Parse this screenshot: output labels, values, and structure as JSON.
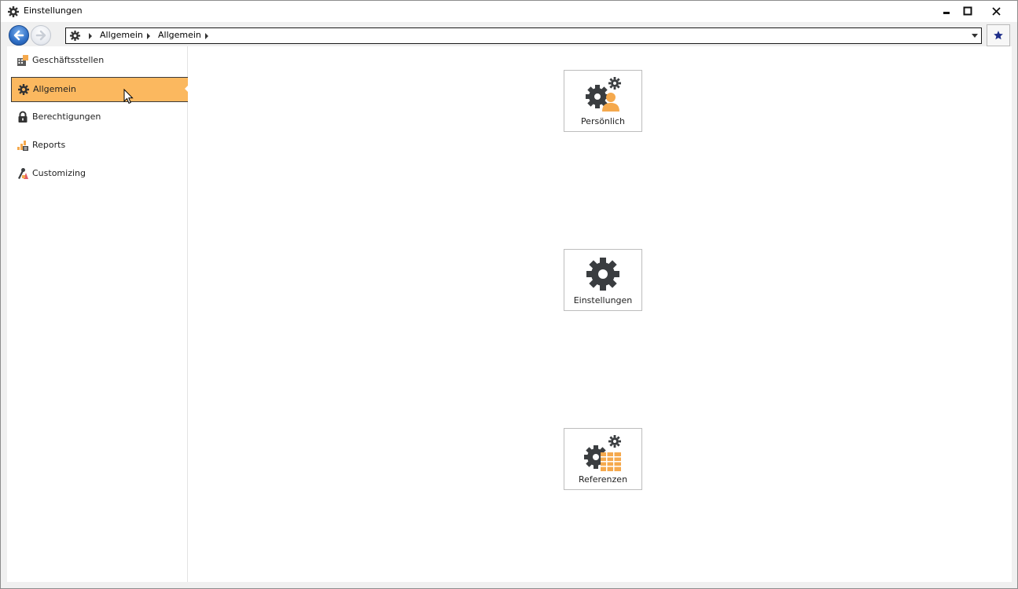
{
  "window": {
    "title": "Einstellungen"
  },
  "addressbar": {
    "crumbs": [
      "Allgemein",
      "Allgemein"
    ]
  },
  "sidebar": {
    "items": [
      {
        "label": "Geschäftsstellen",
        "icon": "building-icon",
        "active": false
      },
      {
        "label": "Allgemein",
        "icon": "gear-icon",
        "active": true
      },
      {
        "label": "Berechtigungen",
        "icon": "lock-icon",
        "active": false
      },
      {
        "label": "Reports",
        "icon": "reports-icon",
        "active": false
      },
      {
        "label": "Customizing",
        "icon": "customizing-icon",
        "active": false
      }
    ]
  },
  "tiles": [
    {
      "label": "Persönlich",
      "icon": "gear-person-icon"
    },
    {
      "label": "Einstellungen",
      "icon": "gear-icon"
    },
    {
      "label": "Referenzen",
      "icon": "gear-table-icon"
    }
  ],
  "colors": {
    "accent": "#fbb85f",
    "icon_dark": "#3a3d40",
    "icon_orange": "#f5a94d"
  }
}
